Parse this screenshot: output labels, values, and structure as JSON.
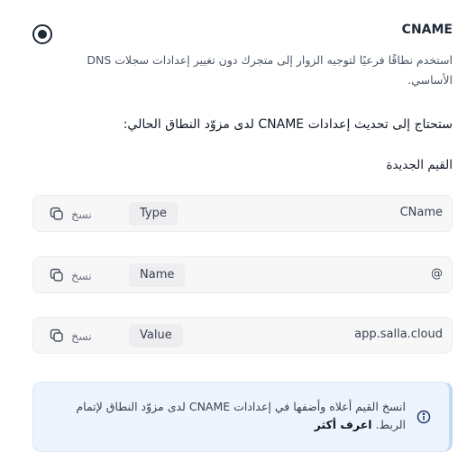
{
  "option": {
    "title": "CNAME",
    "description": "استخدم نطاقًا فرعيًا لتوجيه الزوار إلى متجرك دون تغيير إعدادات سجلات DNS الأساسي."
  },
  "instruction": "ستحتاج إلى تحديث إعدادات CNAME لدى مزوّد النطاق الحالي:",
  "new_values_label": "القيم الجديدة",
  "copy_label": "نسخ",
  "records": [
    {
      "key": "Type",
      "value": "CName"
    },
    {
      "key": "Name",
      "value": "@"
    },
    {
      "key": "Value",
      "value": "app.salla.cloud"
    }
  ],
  "info": {
    "text": "انسخ القيم أعلاه وأضفها في إعدادات CNAME لدى مزوّد النطاق لإتمام الربط.",
    "learn_more": "اعرف أكثر"
  }
}
